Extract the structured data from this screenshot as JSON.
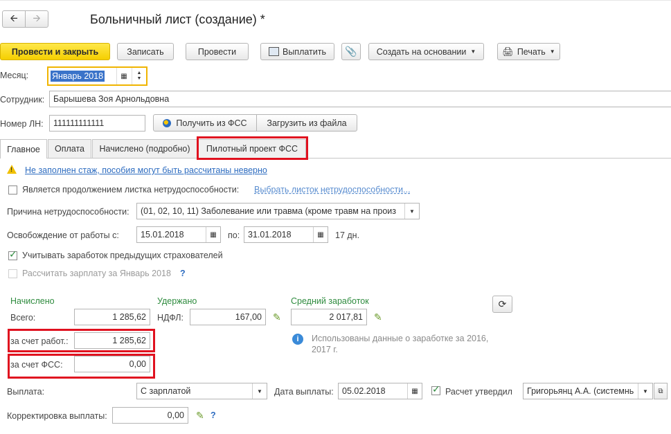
{
  "window": {
    "title": "Больничный лист (создание) *"
  },
  "toolbar": {
    "post_close": "Провести и закрыть",
    "save": "Записать",
    "post": "Провести",
    "pay": "Выплатить",
    "create_based": "Создать на основании",
    "print": "Печать"
  },
  "header": {
    "month_label": "Месяц:",
    "month_value": "Январь 2018",
    "employee_label": "Сотрудник:",
    "employee_value": "Барышева Зоя Арнольдовна",
    "ln_label": "Номер ЛН:",
    "ln_value": "111111111111",
    "get_fss": "Получить из ФСС",
    "load_file": "Загрузить из файла"
  },
  "tabs": [
    {
      "label": "Главное"
    },
    {
      "label": "Оплата"
    },
    {
      "label": "Начислено (подробно)"
    },
    {
      "label": "Пилотный проект ФСС"
    }
  ],
  "main": {
    "warning": "Не заполнен стаж, пособия могут быть рассчитаны неверно",
    "continuation_label": "Является продолжением листка нетрудоспособности:",
    "continuation_link": "Выбрать листок нетрудоспособности...",
    "reason_label": "Причина нетрудоспособности:",
    "reason_value": "(01, 02, 10, 11) Заболевание или травма (кроме травм на произ",
    "release_label": "Освобождение от работы с:",
    "release_from": "15.01.2018",
    "release_to_label": "по:",
    "release_to": "31.01.2018",
    "days": "17 дн.",
    "prev_employers": "Учитывать заработок предыдущих страхователей",
    "calc_salary": "Рассчитать зарплату за Январь 2018",
    "help": "?"
  },
  "accrued": {
    "title": "Начислено",
    "total_label": "Всего:",
    "total_value": "1 285,62",
    "employer_label": "за счет работ.:",
    "employer_value": "1 285,62",
    "fss_label": "за счет ФСС:",
    "fss_value": "0,00"
  },
  "withheld": {
    "title": "Удержано",
    "ndfl_label": "НДФЛ:",
    "ndfl_value": "167,00"
  },
  "average": {
    "title": "Средний заработок",
    "value": "2 017,81",
    "info": "Использованы данные о заработке за 2016,  2017 г."
  },
  "payment": {
    "label": "Выплата:",
    "value": "С зарплатой",
    "date_label": "Дата выплаты:",
    "date_value": "05.02.2018",
    "approved_label": "Расчет утвердил",
    "approved_value": "Григорьянц А.А. (системнь",
    "correction_label": "Корректировка выплаты:",
    "correction_value": "0,00",
    "help": "?"
  },
  "colors": {
    "primary_button": "#f5cf00",
    "highlight_border": "#e0111f",
    "section_green": "#2e8b3e",
    "link_blue": "#2d6cc0",
    "focus_orange": "#f0b400"
  }
}
